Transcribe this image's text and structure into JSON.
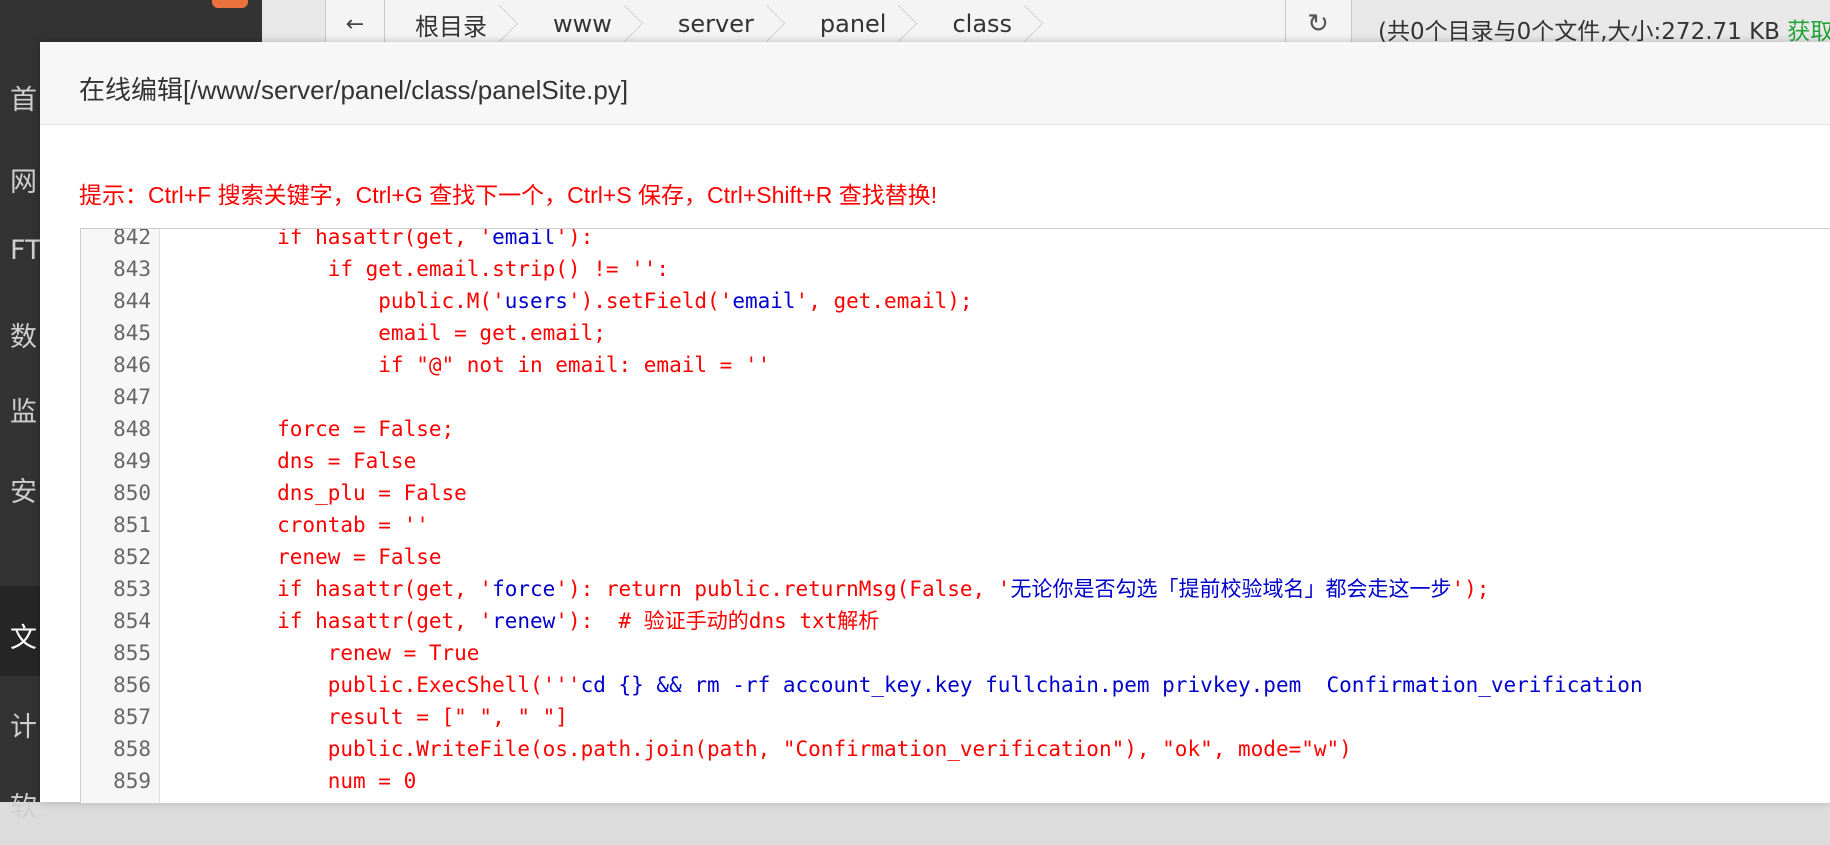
{
  "sidebar": {
    "items": [
      {
        "label": "首",
        "active": false
      },
      {
        "label": "网",
        "active": false
      },
      {
        "label": "FT",
        "active": false
      },
      {
        "label": "数",
        "active": false
      },
      {
        "label": "监",
        "active": false
      },
      {
        "label": "安",
        "active": false
      },
      {
        "label": "文",
        "active": true
      },
      {
        "label": "计",
        "active": false
      },
      {
        "label": "软",
        "active": false
      }
    ]
  },
  "pathbar": {
    "crumbs": [
      "根目录",
      "www",
      "server",
      "panel",
      "class"
    ],
    "summary": "(共0个目录与0个文件,大小:272.71 KB",
    "summary_link": "获取"
  },
  "modal": {
    "title": "在线编辑[/www/server/panel/class/panelSite.py]",
    "hint": "提示：Ctrl+F 搜索关键字，Ctrl+G 查找下一个，Ctrl+S 保存，Ctrl+Shift+R 查找替换!"
  },
  "editor": {
    "lines": [
      {
        "num": "842",
        "parts": [
          {
            "t": "        if hasattr(get, '"
          },
          {
            "t": "email",
            "s": 1
          },
          {
            "t": "'):"
          }
        ]
      },
      {
        "num": "843",
        "parts": [
          {
            "t": "            if get.email.strip() != '':"
          }
        ]
      },
      {
        "num": "844",
        "parts": [
          {
            "t": "                public.M('"
          },
          {
            "t": "users",
            "s": 1
          },
          {
            "t": "').setField('"
          },
          {
            "t": "email",
            "s": 1
          },
          {
            "t": "', get.email);"
          }
        ]
      },
      {
        "num": "845",
        "parts": [
          {
            "t": "                email = get.email;"
          }
        ]
      },
      {
        "num": "846",
        "parts": [
          {
            "t": "                if \"@\" not in email: email = ''"
          }
        ]
      },
      {
        "num": "847",
        "parts": [
          {
            "t": ""
          }
        ]
      },
      {
        "num": "848",
        "parts": [
          {
            "t": "        force = False;"
          }
        ]
      },
      {
        "num": "849",
        "parts": [
          {
            "t": "        dns = False"
          }
        ]
      },
      {
        "num": "850",
        "parts": [
          {
            "t": "        dns_plu = False"
          }
        ]
      },
      {
        "num": "851",
        "parts": [
          {
            "t": "        crontab = ''"
          }
        ]
      },
      {
        "num": "852",
        "parts": [
          {
            "t": "        renew = False"
          }
        ]
      },
      {
        "num": "853",
        "parts": [
          {
            "t": "        if hasattr(get, '"
          },
          {
            "t": "force",
            "s": 1
          },
          {
            "t": "'): return public.returnMsg(False, '"
          },
          {
            "t": "无论你是否勾选「提前校验域名」都会走这一步",
            "s": 1
          },
          {
            "t": "');"
          }
        ]
      },
      {
        "num": "854",
        "parts": [
          {
            "t": "        if hasattr(get, '"
          },
          {
            "t": "renew",
            "s": 1
          },
          {
            "t": "'):  # 验证手动的dns txt解析"
          }
        ]
      },
      {
        "num": "855",
        "parts": [
          {
            "t": "            renew = True"
          }
        ]
      },
      {
        "num": "856",
        "parts": [
          {
            "t": "            public.ExecShell('''"
          },
          {
            "t": "cd {} && rm -rf account_key.key fullchain.pem privkey.pem  Confirmation_verification",
            "s": 1
          }
        ]
      },
      {
        "num": "857",
        "parts": [
          {
            "t": "            result = [\" \", \" \"]"
          }
        ]
      },
      {
        "num": "858",
        "parts": [
          {
            "t": "            public.WriteFile(os.path.join(path, \"Confirmation_verification\"), \"ok\", mode=\"w\")"
          }
        ]
      },
      {
        "num": "859",
        "parts": [
          {
            "t": "            num = 0"
          }
        ]
      }
    ]
  }
}
